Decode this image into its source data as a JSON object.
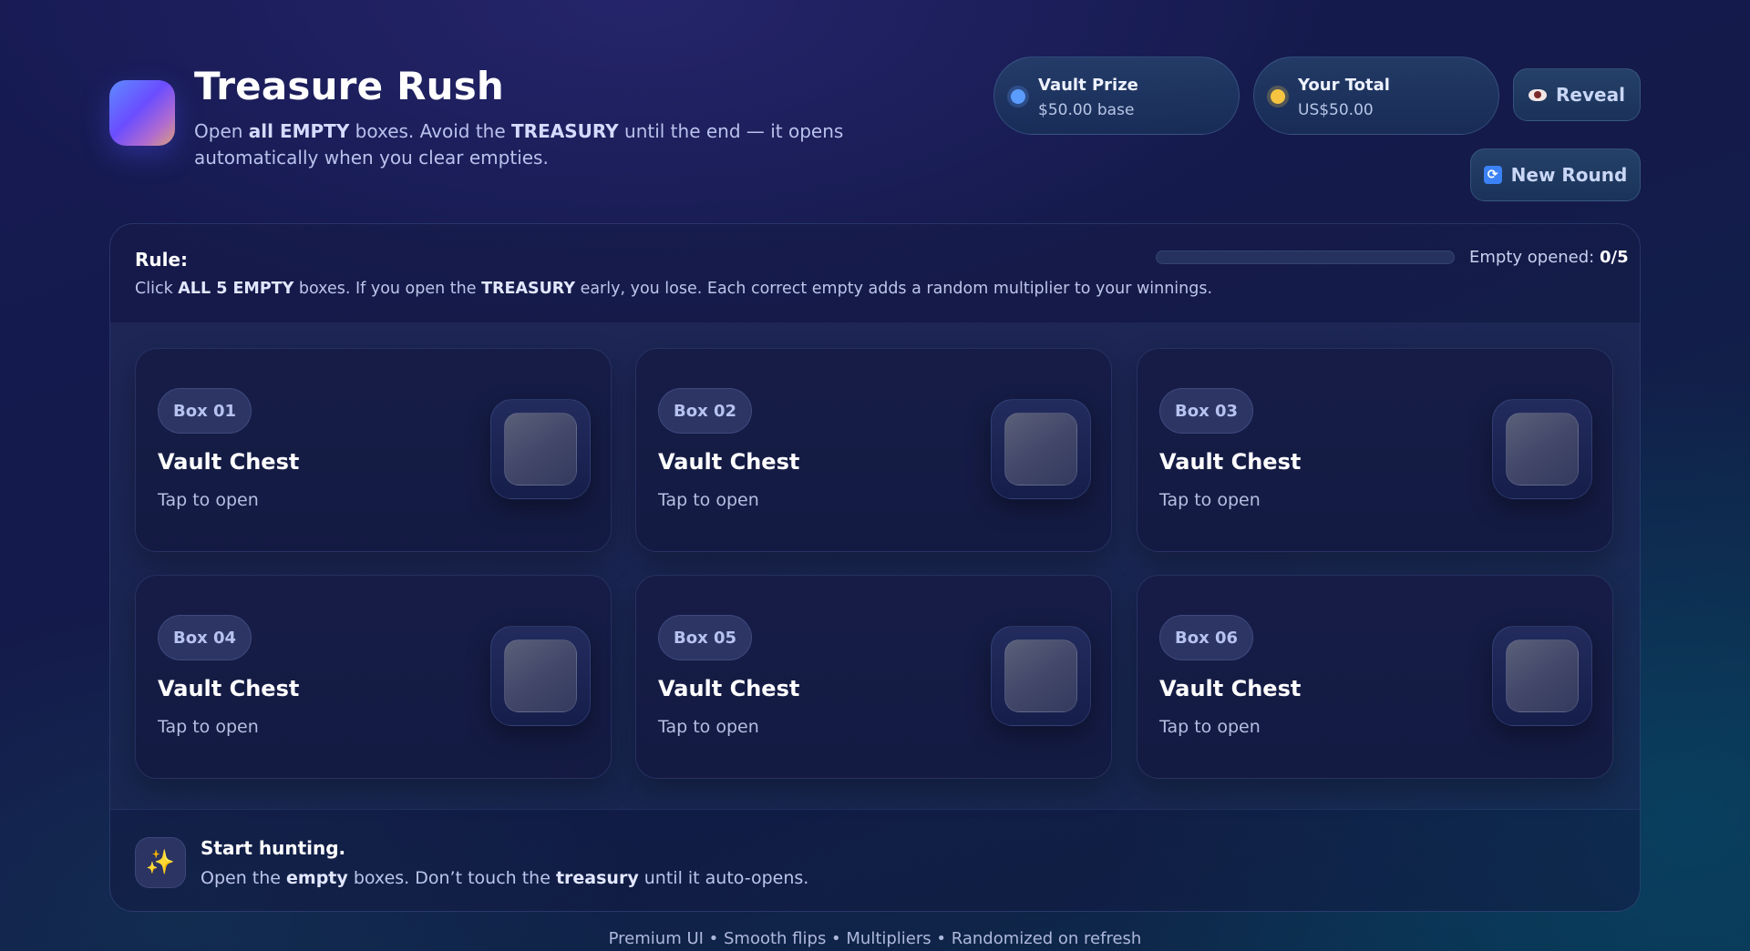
{
  "header": {
    "title": "Treasure Rush",
    "subtitle": {
      "p1": "Open ",
      "b1": "all EMPTY",
      "p2": " boxes. Avoid the ",
      "b2": "TREASURY",
      "p3": " until the end — it opens automatically when you clear empties."
    }
  },
  "stats": {
    "prize": {
      "label": "Vault Prize",
      "value": "$50.00 base",
      "color": "#5b9cff"
    },
    "total": {
      "label": "Your Total",
      "value": "US$50.00",
      "color": "#f5c542"
    }
  },
  "buttons": {
    "reveal": "Reveal",
    "new_round": "New Round"
  },
  "rule": {
    "title": "Rule:",
    "p1": "Click ",
    "b1": "ALL 5 EMPTY",
    "p2": " boxes. If you open the ",
    "b2": "TREASURY",
    "p3": " early, you lose. Each correct empty adds a random multiplier to your winnings."
  },
  "progress": {
    "label": "Empty opened: ",
    "value": "0/5",
    "opened": 0,
    "total": 5
  },
  "boxes": [
    {
      "tag": "Box 01",
      "title": "Vault Chest",
      "sub": "Tap to open"
    },
    {
      "tag": "Box 02",
      "title": "Vault Chest",
      "sub": "Tap to open"
    },
    {
      "tag": "Box 03",
      "title": "Vault Chest",
      "sub": "Tap to open"
    },
    {
      "tag": "Box 04",
      "title": "Vault Chest",
      "sub": "Tap to open"
    },
    {
      "tag": "Box 05",
      "title": "Vault Chest",
      "sub": "Tap to open"
    },
    {
      "tag": "Box 06",
      "title": "Vault Chest",
      "sub": "Tap to open"
    }
  ],
  "status": {
    "icon": "sparkles-icon",
    "title": "Start hunting.",
    "p1": "Open the ",
    "b1": "empty",
    "p2": " boxes. Don’t touch the ",
    "b2": "treasury",
    "p3": " until it auto-opens."
  },
  "footer": {
    "credits": "Premium UI • Smooth flips • Multipliers • Randomized on refresh"
  }
}
